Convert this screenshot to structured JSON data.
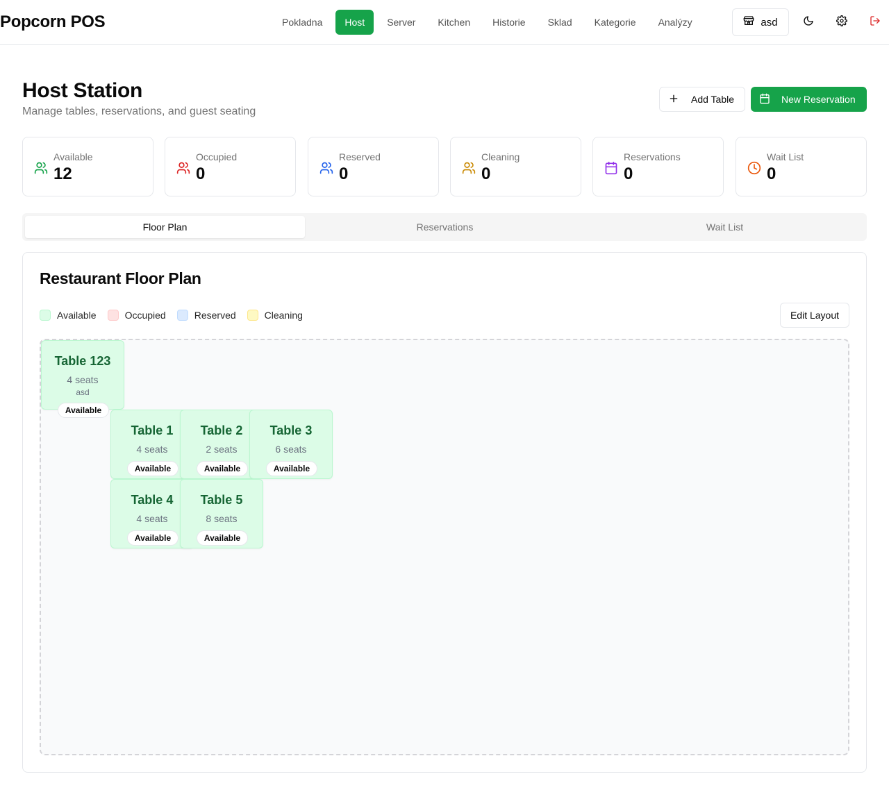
{
  "app": {
    "brand": "Popcorn POS"
  },
  "nav": {
    "items": [
      "Pokladna",
      "Host",
      "Server",
      "Kitchen",
      "Historie",
      "Sklad",
      "Kategorie",
      "Analýzy"
    ],
    "active": "Host"
  },
  "header_actions": {
    "store_label": "asd"
  },
  "page": {
    "title": "Host Station",
    "subtitle": "Manage tables, reservations, and guest seating",
    "add_table_label": "Add Table",
    "new_reservation_label": "New Reservation"
  },
  "stats": [
    {
      "label": "Available",
      "value": "12",
      "icon": "users-icon",
      "color": "#16a34a"
    },
    {
      "label": "Occupied",
      "value": "0",
      "icon": "users-icon",
      "color": "#dc2626"
    },
    {
      "label": "Reserved",
      "value": "0",
      "icon": "users-icon",
      "color": "#2563eb"
    },
    {
      "label": "Cleaning",
      "value": "0",
      "icon": "users-icon",
      "color": "#ca8a04"
    },
    {
      "label": "Reservations",
      "value": "0",
      "icon": "calendar-icon",
      "color": "#9333ea"
    },
    {
      "label": "Wait List",
      "value": "0",
      "icon": "clock-icon",
      "color": "#ea580c"
    }
  ],
  "tabs": [
    "Floor Plan",
    "Reservations",
    "Wait List"
  ],
  "active_tab": "Floor Plan",
  "floor_plan": {
    "title": "Restaurant Floor Plan",
    "legend": [
      {
        "label": "Available",
        "fill": "#dcfce7",
        "border": "#bbf7d0"
      },
      {
        "label": "Occupied",
        "fill": "#fee2e2",
        "border": "#fecaca"
      },
      {
        "label": "Reserved",
        "fill": "#dbeafe",
        "border": "#bfdbfe"
      },
      {
        "label": "Cleaning",
        "fill": "#fef9c3",
        "border": "#fde68a"
      }
    ],
    "edit_layout_label": "Edit Layout",
    "tables": [
      {
        "name": "Table 123",
        "seats": "4 seats",
        "note": "asd",
        "status": "Available"
      },
      {
        "name": "Table 1",
        "seats": "4 seats",
        "note": "",
        "status": "Available"
      },
      {
        "name": "Table 2",
        "seats": "2 seats",
        "note": "",
        "status": "Available"
      },
      {
        "name": "Table 3",
        "seats": "6 seats",
        "note": "",
        "status": "Available"
      },
      {
        "name": "Table 4",
        "seats": "4 seats",
        "note": "",
        "status": "Available"
      },
      {
        "name": "Table 5",
        "seats": "8 seats",
        "note": "",
        "status": "Available"
      }
    ]
  }
}
